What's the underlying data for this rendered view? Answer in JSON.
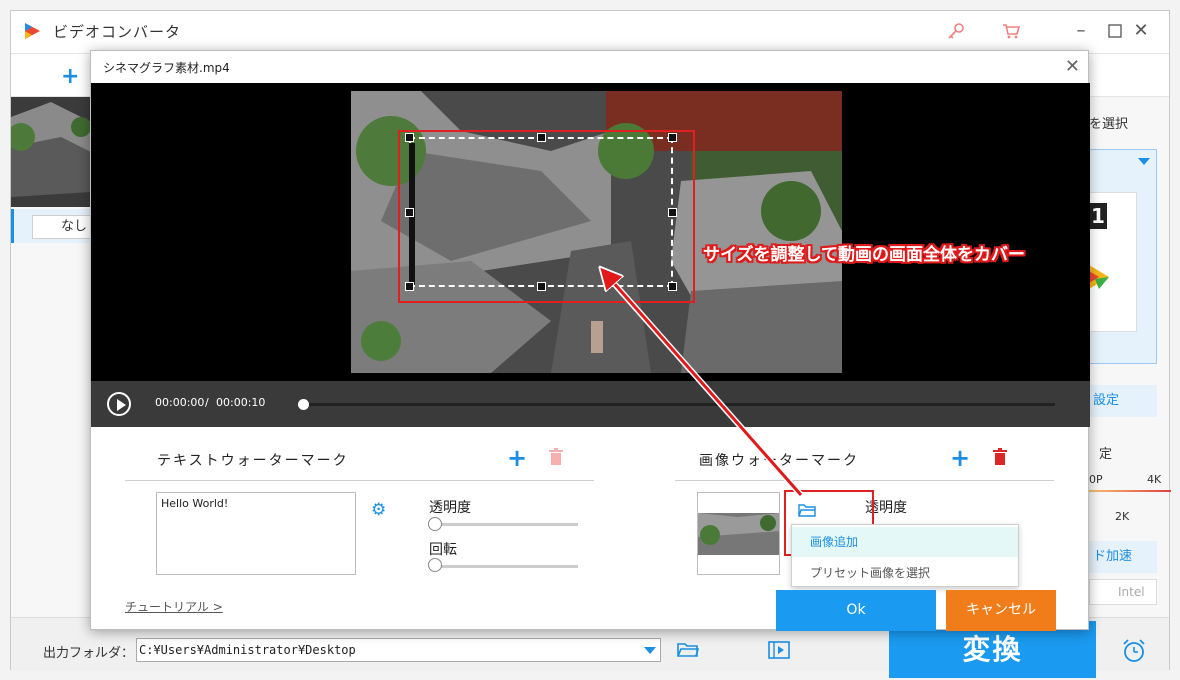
{
  "app": {
    "title": "ビデオコンバータ"
  },
  "left": {
    "text_mark_none": "なし",
    "T_glyph": "T"
  },
  "right": {
    "format_label": "変換先選択",
    "format_label_visible": "を選択",
    "settings_label": "設定",
    "quality_label": "定",
    "res_low": "0P",
    "res_high": "4K",
    "res_mid": "2K",
    "hw_accel": "ド加速",
    "intel": "Intel"
  },
  "bottom": {
    "output_label": "出力フォルダ：",
    "output_path": "C:¥Users¥Administrator¥Desktop",
    "convert_label": "変換"
  },
  "dialog": {
    "title": "シネマグラフ素材.mp4",
    "time_current": "00:00:00",
    "time_separator": "/",
    "time_total": "00:00:10",
    "text_watermark_title": "テキストウォーターマーク",
    "image_watermark_title": "画像ウォーターマーク",
    "text_value": "Hello World!",
    "opacity_label": "透明度",
    "rotation_label": "回転",
    "image_opacity_label": "透明度",
    "dropdown": [
      "画像追加",
      "プリセット画像を選択"
    ],
    "tutorial": "チュートリアル >",
    "ok_label": "Ok",
    "cancel_label": "キャンセル"
  },
  "annotation": "サイズを調整して動画の画面全体をカバー",
  "colors": {
    "accent": "#1a9af0",
    "cancel": "#f07c1a",
    "annotation": "#e01a1a"
  },
  "icons": [
    "app-logo-icon",
    "key-icon",
    "cart-icon",
    "minimize-icon",
    "maximize-icon",
    "close-icon",
    "plus-icon",
    "trash-icon",
    "gear-icon",
    "folder-icon",
    "play-icon",
    "film-icon",
    "alarm-icon"
  ]
}
